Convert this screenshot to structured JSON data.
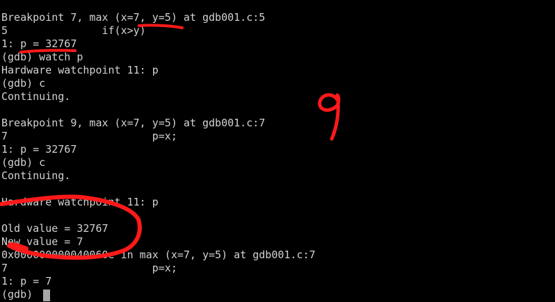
{
  "terminal": {
    "lines": [
      "Breakpoint 7, max (x=7, y=5) at gdb001.c:5",
      "5               if(x>y)",
      "1: p = 32767",
      "(gdb) watch p",
      "Hardware watchpoint 11: p",
      "(gdb) c",
      "Continuing.",
      "",
      "Breakpoint 9, max (x=7, y=5) at gdb001.c:7",
      "7                       p=x;",
      "1: p = 32767",
      "(gdb) c",
      "Continuing.",
      "",
      "Hardware watchpoint 11: p",
      "",
      "Old value = 32767",
      "New value = 7",
      "0x000000000040060e in max (x=7, y=5) at gdb001.c:7",
      "7                       p=x;",
      "1: p = 7",
      "(gdb) "
    ]
  },
  "annotation": {
    "handwritten_number": "9",
    "ink_color": "#ff1a1a"
  },
  "colors": {
    "background": "#000000",
    "text": "#d3d3d3",
    "cursor": "#a8a8a8"
  }
}
